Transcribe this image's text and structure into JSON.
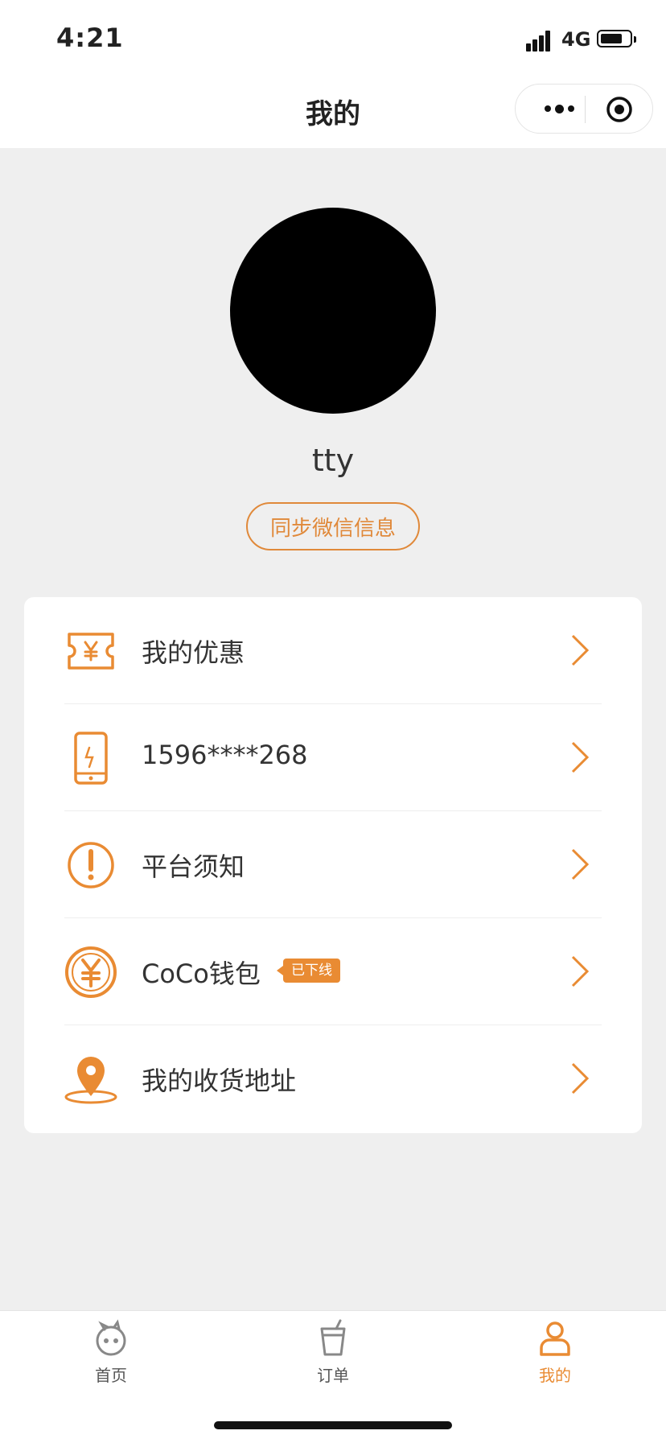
{
  "status_bar": {
    "time": "4:21",
    "network": "4G",
    "battery_level": 0.75
  },
  "nav": {
    "title": "我的"
  },
  "profile": {
    "username": "tty",
    "sync_button": "同步微信信息"
  },
  "menu": [
    {
      "label": "我的优惠",
      "icon": "coupon-icon"
    },
    {
      "label": "1596****268",
      "icon": "phone-icon"
    },
    {
      "label": "平台须知",
      "icon": "exclamation-icon"
    },
    {
      "label": "CoCo钱包",
      "icon": "yen-coin-icon",
      "badge": "已下线"
    },
    {
      "label": "我的收货地址",
      "icon": "location-pin-icon"
    }
  ],
  "tabs": [
    {
      "label": "首页",
      "icon": "home-mascot-icon",
      "active": false
    },
    {
      "label": "订单",
      "icon": "cup-icon",
      "active": false
    },
    {
      "label": "我的",
      "icon": "person-icon",
      "active": true
    }
  ],
  "colors": {
    "accent": "#e98b33",
    "background": "#efefef",
    "card": "#ffffff"
  }
}
